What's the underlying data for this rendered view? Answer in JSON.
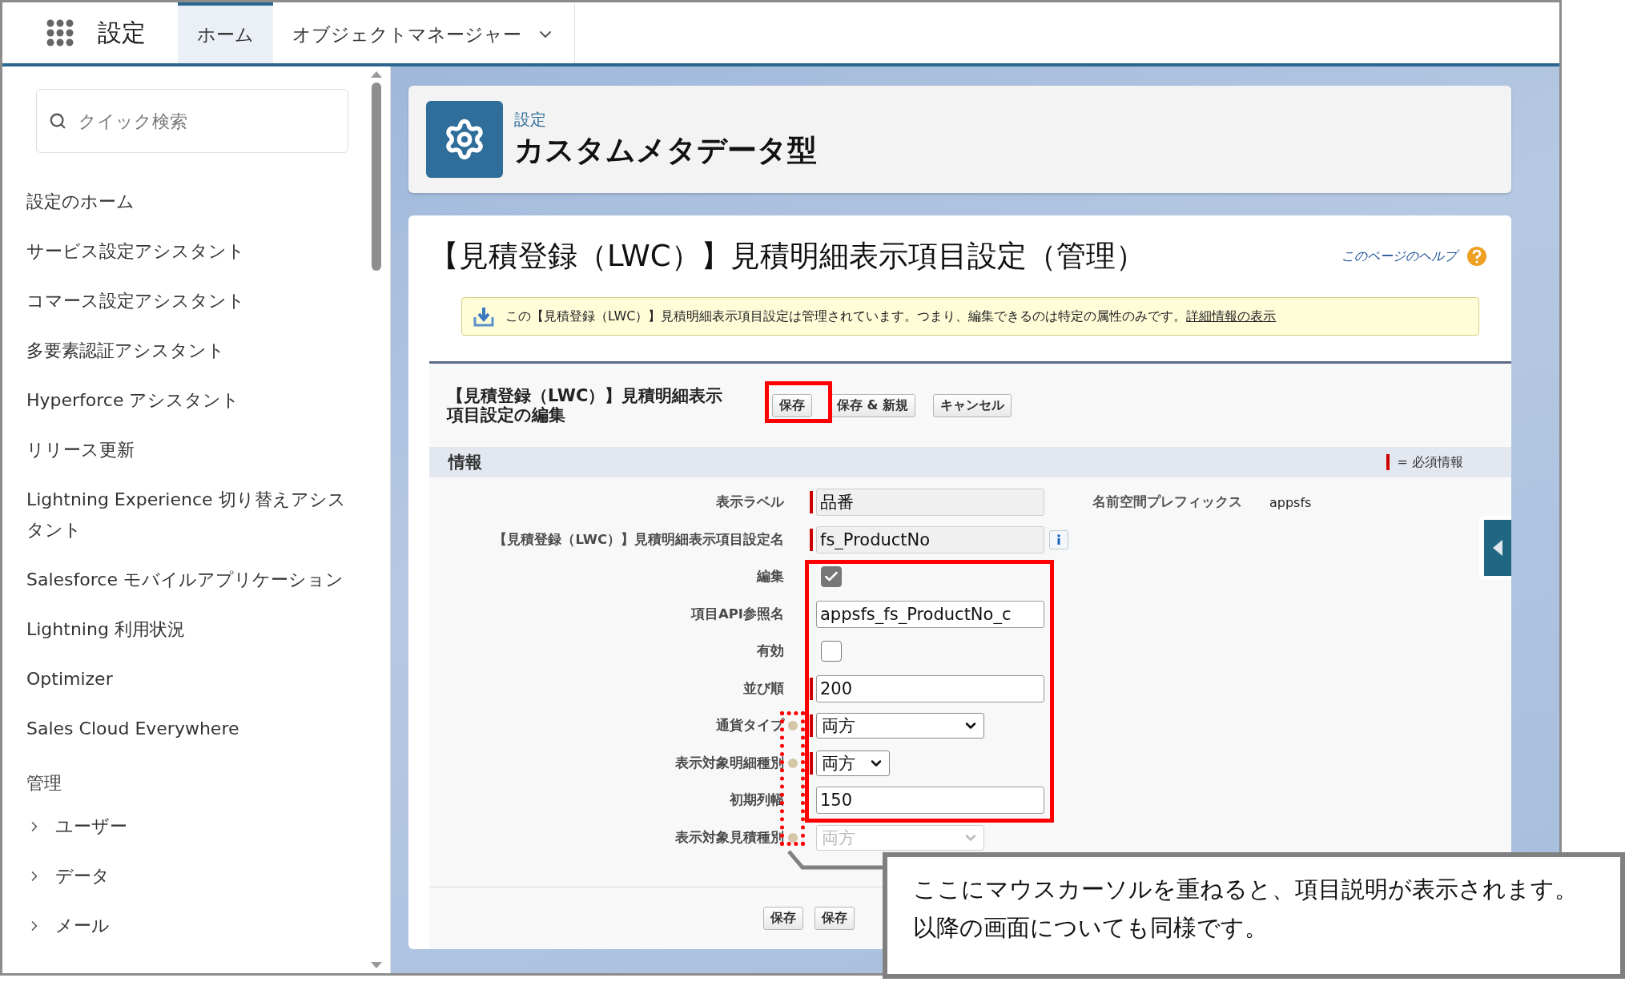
{
  "header": {
    "title": "設定",
    "tabs": [
      {
        "label": "ホーム",
        "selected": true,
        "dropdown": false
      },
      {
        "label": "オブジェクトマネージャー",
        "selected": false,
        "dropdown": true
      }
    ]
  },
  "sidebar": {
    "search": {
      "placeholder": "クイック検索"
    },
    "items": [
      "設定のホーム",
      "サービス設定アシスタント",
      "コマース設定アシスタント",
      "多要素認証アシスタント",
      "Hyperforce アシスタント",
      "リリース更新",
      "Lightning Experience 切り替えアシスタント",
      "Salesforce モバイルアプリケーション",
      "Lightning 利用状況",
      "Optimizer",
      "Sales Cloud Everywhere"
    ],
    "section": "管理",
    "groups": [
      {
        "label": "ユーザー",
        "expanded": false
      },
      {
        "label": "データ",
        "expanded": false
      },
      {
        "label": "メール",
        "expanded": false
      }
    ]
  },
  "page_header": {
    "eyebrow": "設定",
    "title": "カスタムメタデータ型"
  },
  "record": {
    "title": "【見積登録（LWC）】見積明細表示項目設定（管理）",
    "help_link": "このページのヘルプ",
    "notice": {
      "text": "この【見積登録（LWC）】見積明細表示項目設定は管理されています。つまり、編集できるのは特定の属性のみです。",
      "link": "詳細情報の表示"
    },
    "edit": {
      "title": "【見積登録（LWC）】見積明細表示項目設定の編集",
      "buttons": [
        "保存",
        "保存 & 新規",
        "キャンセル"
      ],
      "section": "情報",
      "required_legend": "= 必須情報",
      "fields": [
        {
          "kind": "text",
          "label": "表示ラベル",
          "value": "品番",
          "readonly": true,
          "required": true,
          "help": false,
          "info": false,
          "aside": {
            "label": "名前空間プレフィックス",
            "value": "appsfs"
          }
        },
        {
          "kind": "text",
          "label": "【見積登録（LWC）】見積明細表示項目設定名",
          "value": "fs_ProductNo",
          "readonly": true,
          "required": true,
          "help": false,
          "info": true
        },
        {
          "kind": "checkbox",
          "label": "編集",
          "checked": true,
          "required": false,
          "help": false
        },
        {
          "kind": "text",
          "label": "項目API参照名",
          "value": "appsfs_fs_ProductNo_c",
          "readonly": false,
          "required": false,
          "help": false,
          "info": false
        },
        {
          "kind": "checkbox",
          "label": "有効",
          "checked": false,
          "required": false,
          "help": false
        },
        {
          "kind": "text",
          "label": "並び順",
          "value": "200",
          "readonly": false,
          "required": true,
          "help": false,
          "info": false
        },
        {
          "kind": "select",
          "label": "通貨タイプ",
          "value": "両方",
          "wide": true,
          "disabled": false,
          "required": true,
          "help": true
        },
        {
          "kind": "select",
          "label": "表示対象明細種別",
          "value": "両方",
          "wide": false,
          "disabled": false,
          "required": true,
          "help": true
        },
        {
          "kind": "text",
          "label": "初期列幅",
          "value": "150",
          "readonly": false,
          "required": false,
          "help": false,
          "info": false
        },
        {
          "kind": "select",
          "label": "表示対象見積種別",
          "value": "両方",
          "wide": true,
          "disabled": true,
          "required": false,
          "help": true
        }
      ],
      "bottom_buttons": [
        "保存",
        "保存"
      ]
    }
  },
  "annotation": {
    "lines": [
      "ここにマウスカーソルを重ねると、項目説明が表示されます。",
      "以降の画面についても同様です。"
    ]
  }
}
